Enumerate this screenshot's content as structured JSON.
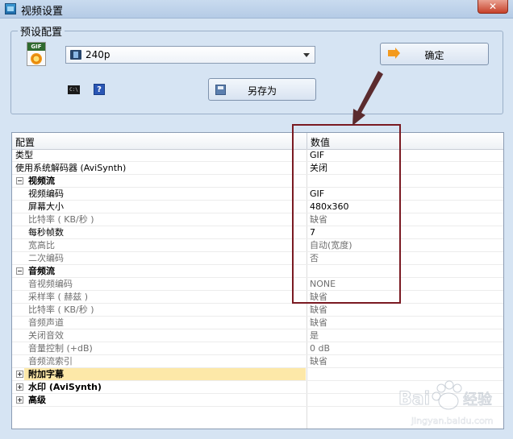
{
  "window": {
    "title": "视频设置",
    "close_glyph": "✕"
  },
  "preset": {
    "group_label": "预设配置",
    "selected": "240p",
    "ok_label": "确定",
    "save_as_label": "另存为",
    "gif_icon_text": "GIF",
    "cmd_icon_text": "C:\\",
    "help_icon_text": "?"
  },
  "grid": {
    "headers": {
      "name": "配置",
      "value": "数值"
    },
    "rows": [
      {
        "name": "类型",
        "value": "GIF"
      },
      {
        "name": "使用系统解码器 (AviSynth)",
        "value": "关闭"
      },
      {
        "name": "视频流",
        "value": ""
      },
      {
        "name": "视频编码",
        "value": "GIF"
      },
      {
        "name": "屏幕大小",
        "value": "480x360"
      },
      {
        "name": "比特率 ( KB/秒 )",
        "value": "缺省"
      },
      {
        "name": "每秒帧数",
        "value": "7"
      },
      {
        "name": "宽高比",
        "value": "自动(宽度)"
      },
      {
        "name": "二次编码",
        "value": "否"
      },
      {
        "name": "音频流",
        "value": ""
      },
      {
        "name": "音视频编码",
        "value": "NONE"
      },
      {
        "name": "采样率 ( 赫兹 )",
        "value": "缺省"
      },
      {
        "name": "比特率 ( KB/秒 )",
        "value": "缺省"
      },
      {
        "name": "音频声道",
        "value": "缺省"
      },
      {
        "name": "关闭音效",
        "value": "是"
      },
      {
        "name": "音量控制 (+dB)",
        "value": "0 dB"
      },
      {
        "name": "音频流索引",
        "value": "缺省"
      },
      {
        "name": "附加字幕",
        "value": ""
      },
      {
        "name": "水印 (AviSynth)",
        "value": ""
      },
      {
        "name": "高级",
        "value": ""
      }
    ]
  },
  "colors": {
    "window_bg": "#d6e4f3",
    "annotation": "#7a1a22",
    "highlight_row": "#fde8a8"
  },
  "watermark": {
    "brand": "Baidu经验",
    "site": "jingyan.baidu.com"
  }
}
